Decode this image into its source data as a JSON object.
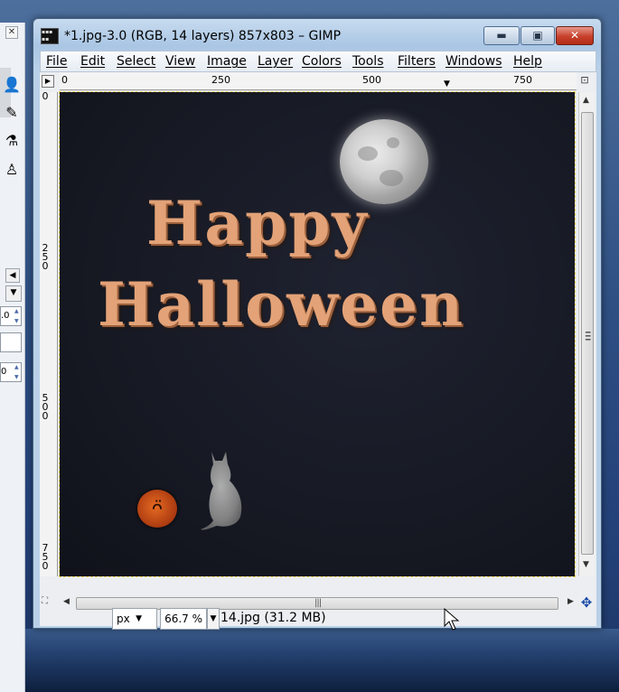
{
  "window": {
    "title": "*1.jpg-3.0 (RGB, 14 layers) 857x803 – GIMP",
    "minimize": "▬",
    "maximize": "▣",
    "close": "✕"
  },
  "menu": [
    "File",
    "Edit",
    "Select",
    "View",
    "Image",
    "Layer",
    "Colors",
    "Tools",
    "Filters",
    "Windows",
    "Help"
  ],
  "rulers": {
    "horizontal": [
      "0",
      "250",
      "500",
      "750"
    ],
    "vertical": [
      [
        "0"
      ],
      [
        "2",
        "5",
        "0"
      ],
      [
        "5",
        "0",
        "0"
      ],
      [
        "7",
        "5",
        "0"
      ]
    ]
  },
  "canvas": {
    "line1": "Happy",
    "line2": "Halloween"
  },
  "toolbox": {
    "field1": ".0",
    "field2": "",
    "field3": "0"
  },
  "statusbar": {
    "unit": "px",
    "zoom": "66.7 %",
    "info": "14.jpg (31.2 MB)"
  },
  "icons": {
    "close_small": "✕",
    "menu_arrow": "▶",
    "nav": "⛶",
    "move": "✥",
    "up": "▲",
    "down": "▼",
    "left": "◀",
    "right": "▶",
    "dropdown": "▼",
    "zoom_corner": "⊡"
  }
}
